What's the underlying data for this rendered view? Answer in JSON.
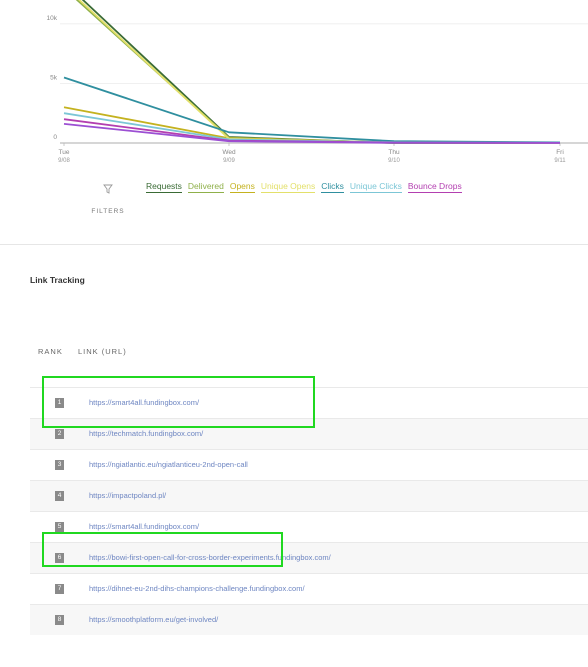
{
  "chart": {
    "y_ticks": [
      "10k",
      "5k",
      "0"
    ],
    "x_ticks": [
      {
        "day": "Tue",
        "date": "9/08"
      },
      {
        "day": "Wed",
        "date": "9/09"
      },
      {
        "day": "Thu",
        "date": "9/10"
      },
      {
        "day": "Fri",
        "date": "9/11"
      }
    ]
  },
  "filters": {
    "label": "FILTERS",
    "icon": "funnel-icon"
  },
  "legend": [
    {
      "label": "Requests",
      "color": "#3a6b35"
    },
    {
      "label": "Delivered",
      "color": "#8fb04a"
    },
    {
      "label": "Opens",
      "color": "#c4b21f"
    },
    {
      "label": "Unique Opens",
      "color": "#e3e06a"
    },
    {
      "label": "Clicks",
      "color": "#2f8f9f"
    },
    {
      "label": "Unique Clicks",
      "color": "#7cc6d6"
    },
    {
      "label": "Bounce Drops",
      "color": "#b33fb0"
    }
  ],
  "chart_data": {
    "type": "line",
    "x": [
      "Tue 9/08",
      "Wed 9/09",
      "Thu 9/10",
      "Fri 9/11"
    ],
    "ylim": [
      0,
      12000
    ],
    "series": [
      {
        "name": "Requests",
        "color": "#3a6b35",
        "values": [
          13500,
          500,
          0,
          0
        ]
      },
      {
        "name": "Delivered",
        "color": "#8fb04a",
        "values": [
          13000,
          450,
          0,
          0
        ]
      },
      {
        "name": "Opens",
        "color": "#c4b21f",
        "values": [
          3000,
          400,
          50,
          20
        ]
      },
      {
        "name": "Unique Opens",
        "color": "#e3e06a",
        "values": [
          13200,
          350,
          40,
          20
        ]
      },
      {
        "name": "Clicks",
        "color": "#2f8f9f",
        "values": [
          5500,
          900,
          150,
          50
        ]
      },
      {
        "name": "Unique Clicks",
        "color": "#7cc6d6",
        "values": [
          2500,
          300,
          60,
          20
        ]
      },
      {
        "name": "Bounce Drops",
        "color": "#b33fb0",
        "values": [
          2000,
          200,
          30,
          10
        ]
      },
      {
        "name": "",
        "color": "#9c4fd3",
        "values": [
          1600,
          150,
          20,
          5
        ]
      }
    ]
  },
  "link_tracking": {
    "title": "Link Tracking",
    "headers": {
      "rank": "RANK",
      "link": "LINK (URL)"
    },
    "rows": [
      {
        "rank": "1",
        "url": "https://smart4all.fundingbox.com/"
      },
      {
        "rank": "2",
        "url": "https://techmatch.fundingbox.com/"
      },
      {
        "rank": "3",
        "url": "https://ngiatlantic.eu/ngiatlanticeu-2nd-open-call"
      },
      {
        "rank": "4",
        "url": "https://impactpoland.pl/"
      },
      {
        "rank": "5",
        "url": "https://smart4all.fundingbox.com/"
      },
      {
        "rank": "6",
        "url": "https://bowi-first-open-call-for-cross-border-experiments.fundingbox.com/"
      },
      {
        "rank": "7",
        "url": "https://dihnet-eu-2nd-dihs-champions-challenge.fundingbox.com/"
      },
      {
        "rank": "8",
        "url": "https://smoothplatform.eu/get-involved/"
      }
    ]
  }
}
